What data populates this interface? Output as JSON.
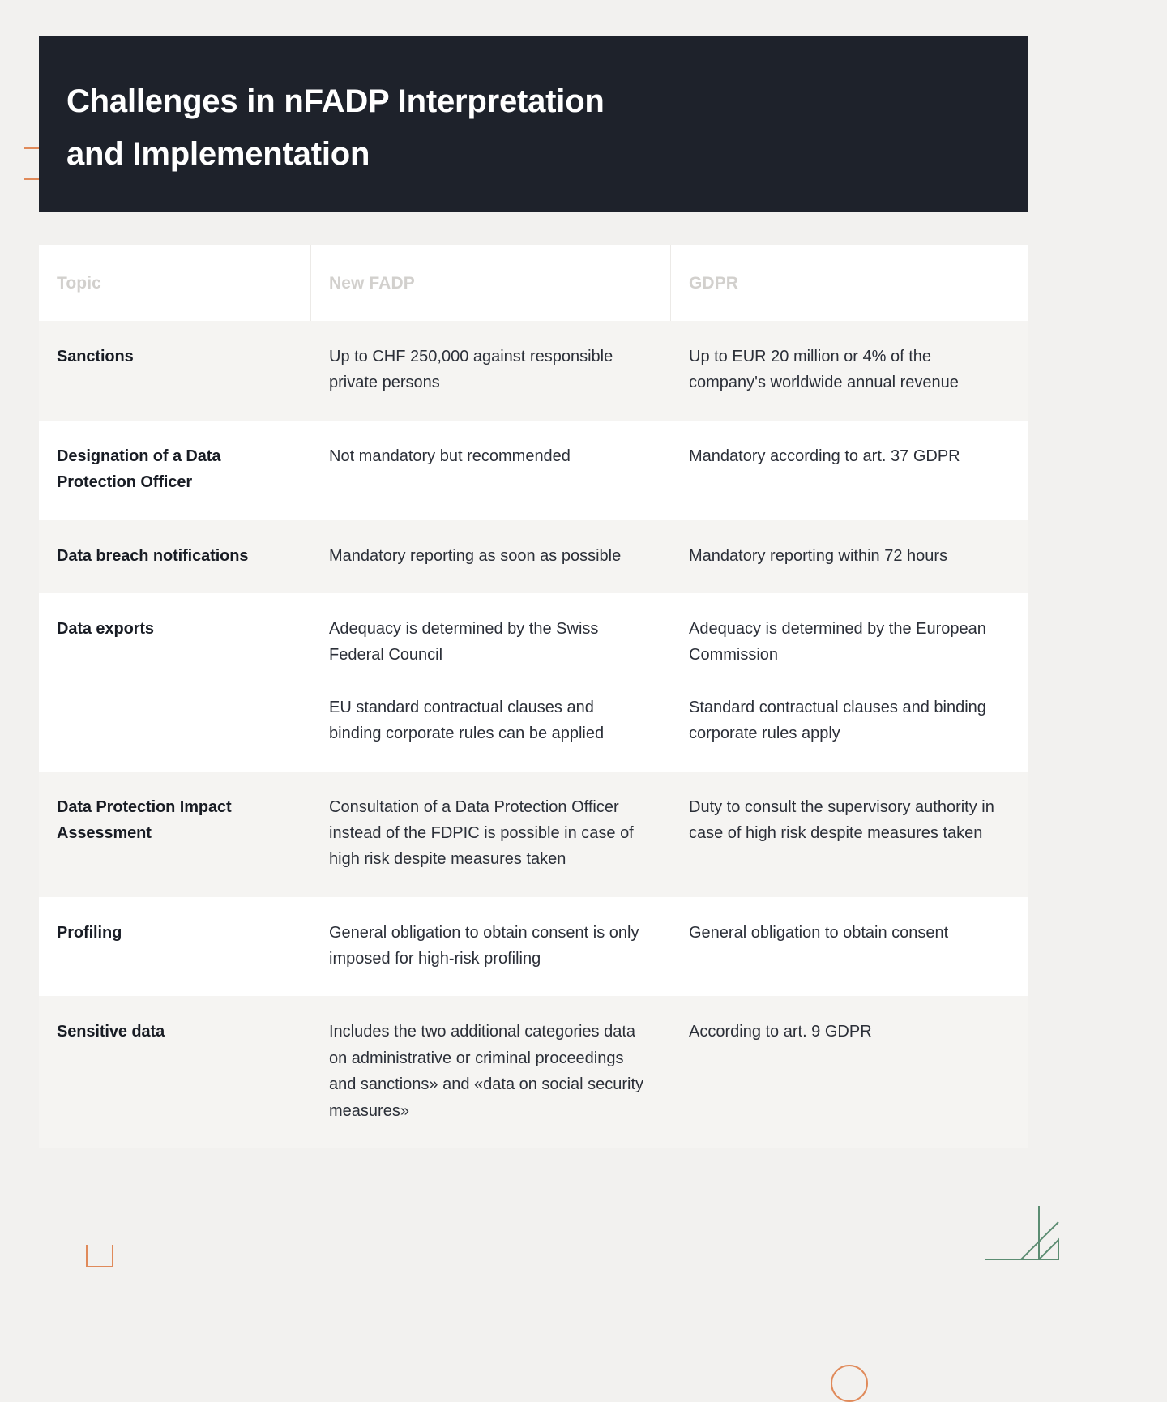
{
  "header": {
    "title_line_1": "Challenges in nFADP Interpretation",
    "title_line_2": "and Implementation",
    "background_color": "#1e222b",
    "text_color": "#ffffff"
  },
  "table": {
    "columns": [
      {
        "key": "topic",
        "label": "Topic"
      },
      {
        "key": "new_fadp",
        "label": "New FADP"
      },
      {
        "key": "gdpr",
        "label": "GDPR"
      }
    ],
    "rows": [
      {
        "topic": "Sanctions",
        "new_fadp": [
          "Up to CHF 250,000 against responsible private persons"
        ],
        "gdpr": [
          "Up to EUR 20 million or 4% of the company's worldwide annual revenue"
        ]
      },
      {
        "topic": "Designation of a Data Protection Officer",
        "new_fadp": [
          "Not mandatory but recommended"
        ],
        "gdpr": [
          "Mandatory according to art. 37 GDPR"
        ]
      },
      {
        "topic": "Data breach notifications",
        "new_fadp": [
          "Mandatory reporting as soon as possible"
        ],
        "gdpr": [
          "Mandatory reporting within 72 hours"
        ]
      },
      {
        "topic": "Data exports",
        "new_fadp": [
          "Adequacy is determined by the Swiss Federal Council",
          "EU standard contractual clauses and binding corporate rules can be applied"
        ],
        "gdpr": [
          "Adequacy is determined by the European Commission",
          "Standard contractual clauses and binding corporate rules apply"
        ]
      },
      {
        "topic": "Data Protection Impact Assessment",
        "new_fadp": [
          "Consultation of a Data Protection Officer instead of the FDPIC is possible in case of high risk despite measures taken"
        ],
        "gdpr": [
          "Duty to consult the supervisory authority in case of high risk despite measures taken"
        ]
      },
      {
        "topic": "Profiling",
        "new_fadp": [
          "General obligation to obtain consent is only imposed for high-risk profiling"
        ],
        "gdpr": [
          "General obligation to obtain consent"
        ]
      },
      {
        "topic": "Sensitive data",
        "new_fadp": [
          "Includes the two additional categories data on administrative or criminal proceedings and sanctions» and «data on social security measures»"
        ],
        "gdpr": [
          "According to art. 9 GDPR"
        ]
      }
    ]
  },
  "decorations": {
    "accent_color": "#e08a5a",
    "arrow_color": "#5c8d72",
    "page_background": "#f2f1ef",
    "row_alt_background": "#f5f4f2",
    "row_plain_background": "#ffffff"
  }
}
